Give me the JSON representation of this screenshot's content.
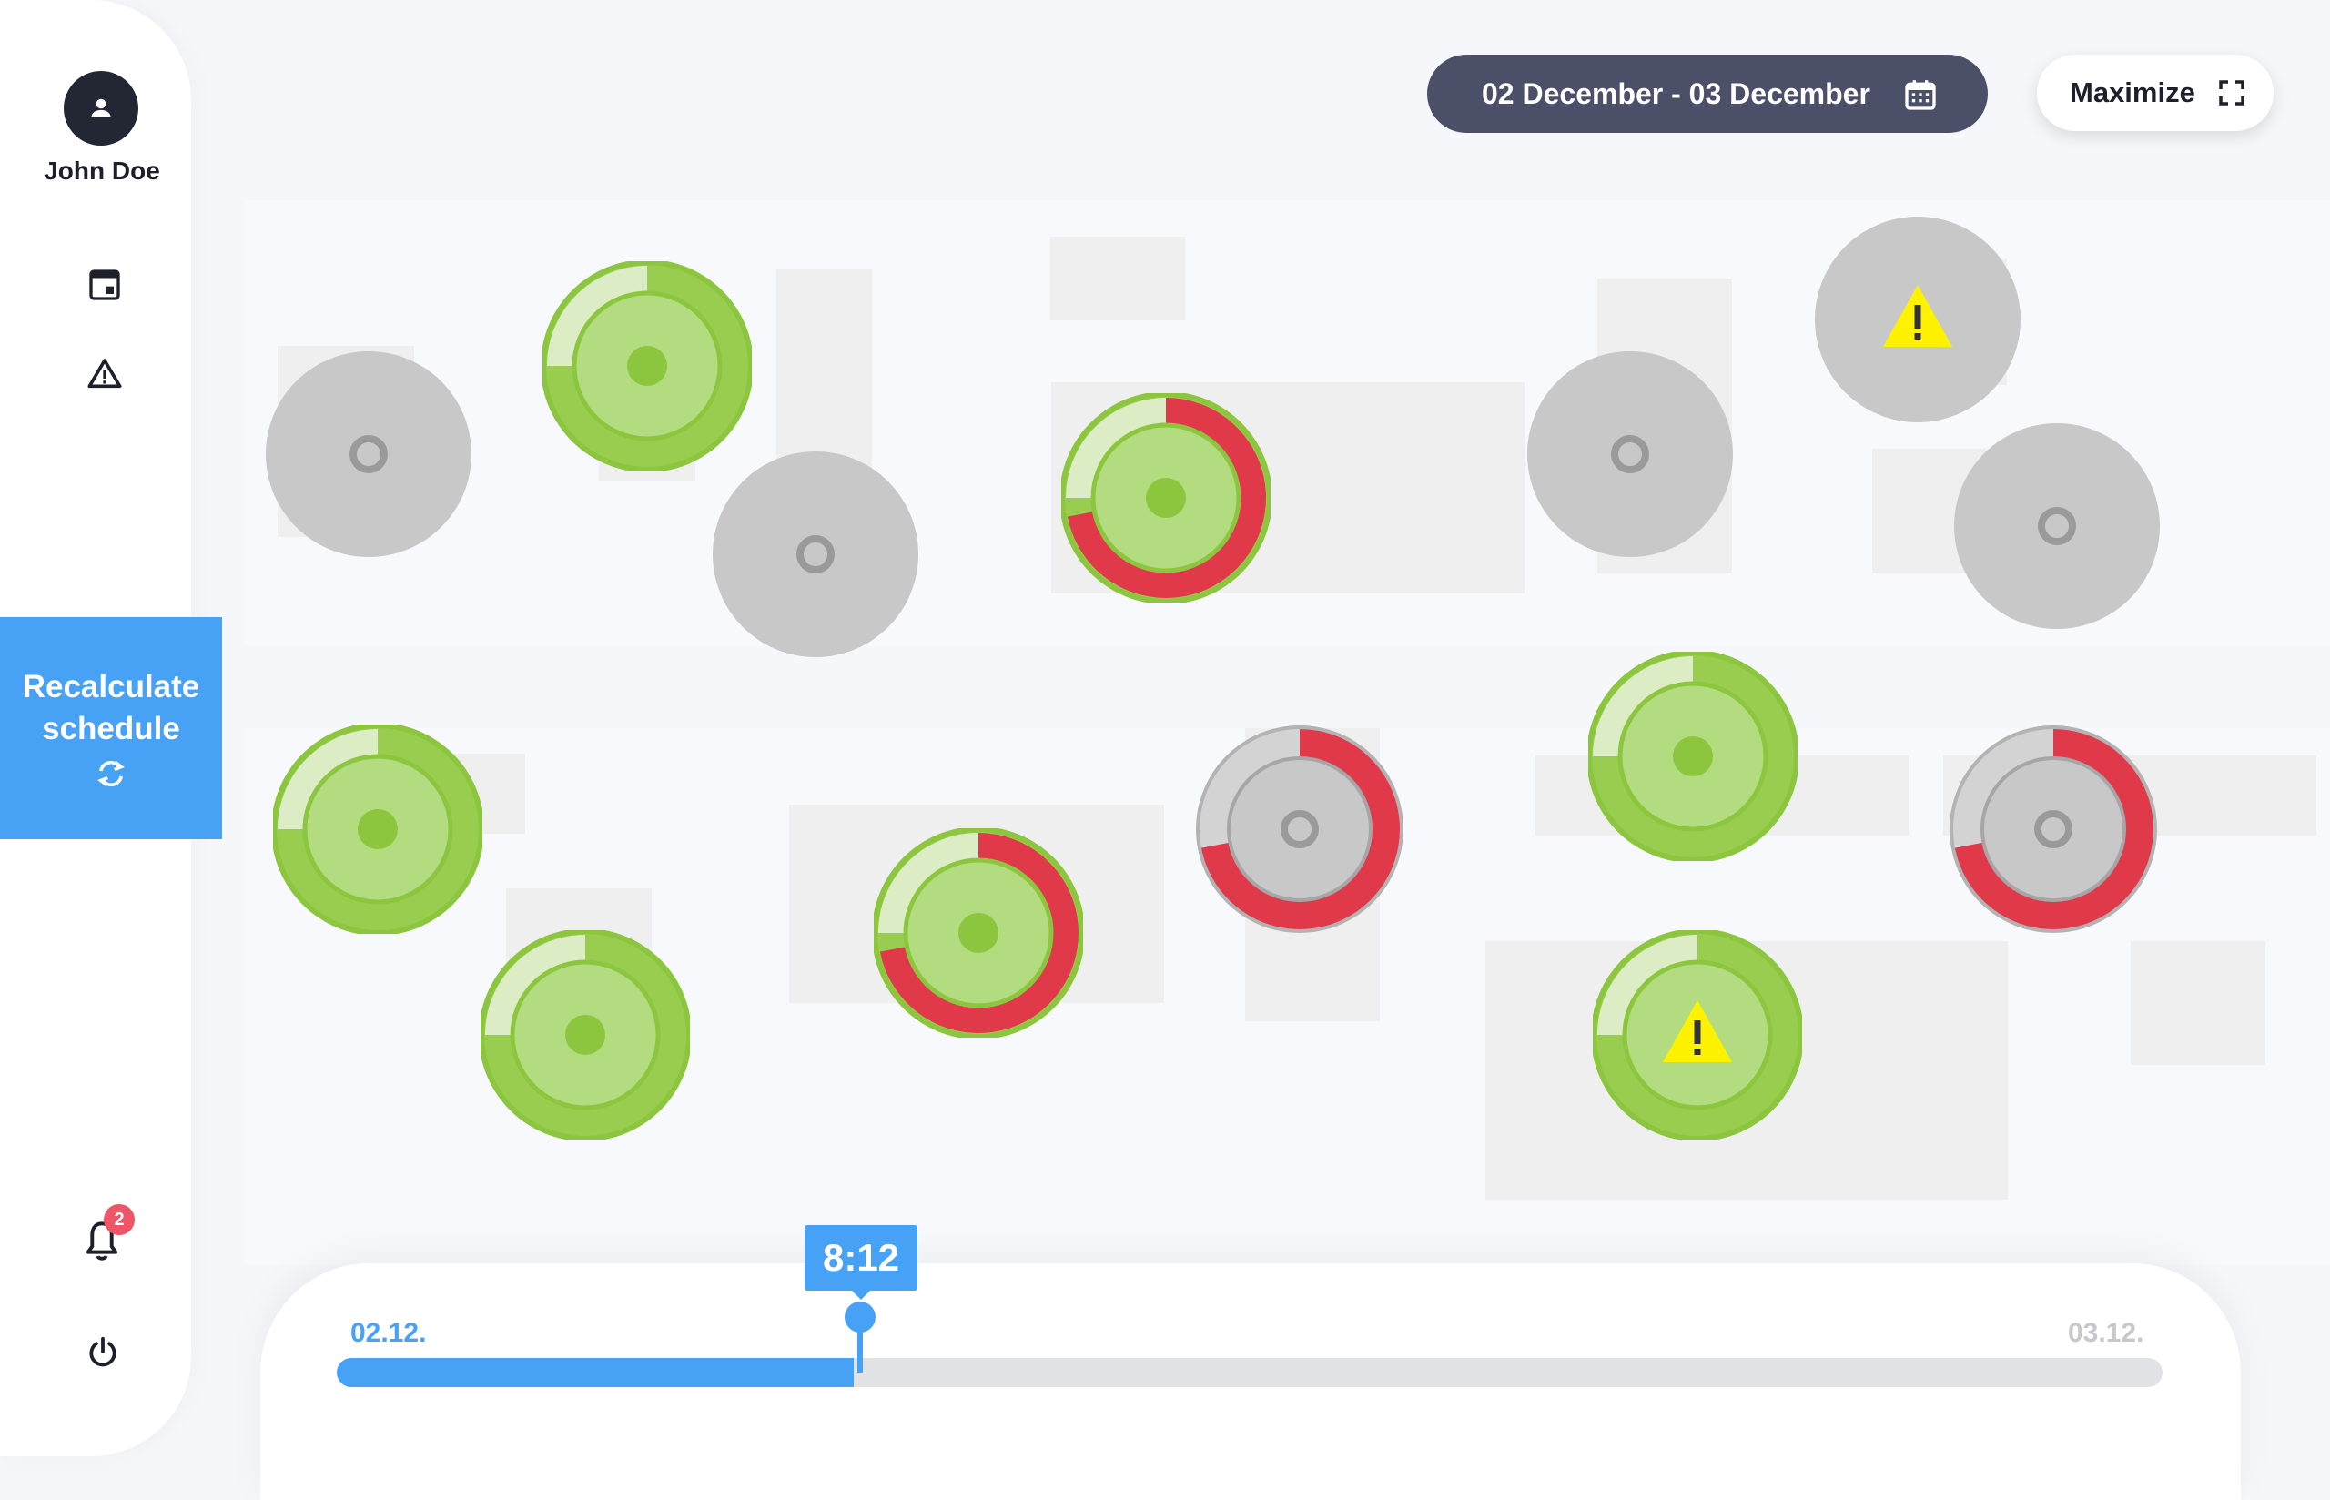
{
  "user": {
    "name": "John Doe"
  },
  "sidebar": {
    "icons": [
      "window-icon",
      "warning-icon",
      "bell-icon",
      "power-icon"
    ],
    "notification_count": "2",
    "recalculate_label": "Recalculate schedule"
  },
  "header": {
    "date_range": "02 December - 03 December",
    "maximize_label": "Maximize"
  },
  "timeline": {
    "start_label": "02.12.",
    "end_label": "03.12.",
    "current_time": "8:12",
    "progress_fraction": 0.283
  },
  "colors": {
    "accent": "#47a2f5",
    "idle": "#c8c8c8",
    "active_green": "#8cc63f",
    "alert_red": "#e03a4a",
    "warning_yellow": "#fff200"
  },
  "machines": [
    {
      "state": "idle",
      "progress": 0,
      "warning": false
    },
    {
      "state": "active",
      "progress": 0,
      "warning": false
    },
    {
      "state": "idle",
      "progress": 0,
      "warning": false
    },
    {
      "state": "active",
      "progress": 0.72,
      "warning": false
    },
    {
      "state": "idle",
      "progress": 0,
      "warning": false
    },
    {
      "state": "idle",
      "progress": 0,
      "warning": true
    },
    {
      "state": "idle",
      "progress": 0,
      "warning": false
    },
    {
      "state": "active",
      "progress": 0,
      "warning": false
    },
    {
      "state": "active",
      "progress": 0,
      "warning": false
    },
    {
      "state": "active",
      "progress": 0.72,
      "warning": false
    },
    {
      "state": "idle",
      "progress": 0.72,
      "warning": false
    },
    {
      "state": "active",
      "progress": 0,
      "warning": false
    },
    {
      "state": "active",
      "progress": 0,
      "warning": true
    },
    {
      "state": "idle",
      "progress": 0.72,
      "warning": false
    }
  ]
}
